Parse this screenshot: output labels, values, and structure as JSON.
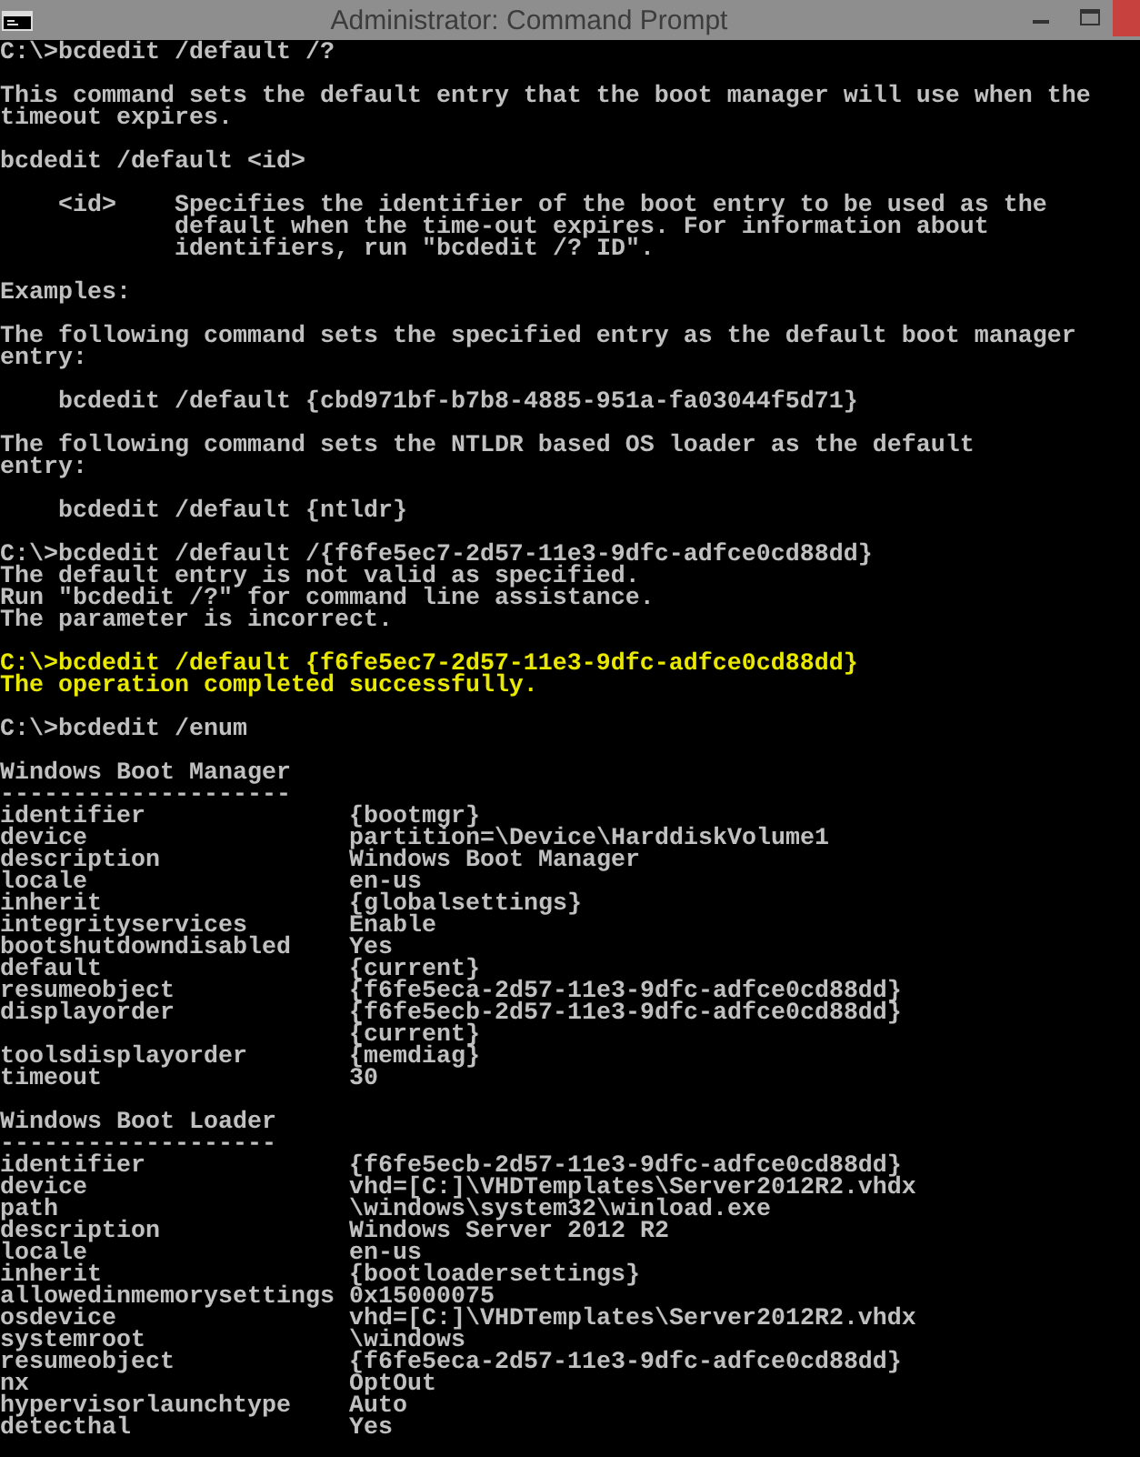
{
  "window": {
    "title": "Administrator: Command Prompt"
  },
  "console": [
    {
      "kind": "text",
      "lines": [
        {
          "text": "C:\\>bcdedit /default /?",
          "indent": false,
          "highlighted": false
        }
      ]
    },
    {
      "kind": "text",
      "lines": [
        {
          "text": "This command sets the default entry that the boot manager will use when the",
          "indent": false,
          "highlighted": false
        },
        {
          "text": "timeout expires.",
          "indent": false,
          "highlighted": false
        }
      ]
    },
    {
      "kind": "text",
      "lines": [
        {
          "text": "bcdedit /default <id>",
          "indent": false,
          "highlighted": false
        }
      ]
    },
    {
      "kind": "param",
      "name": "<id>",
      "lines": [
        "Specifies the identifier of the boot entry to be used as the",
        "default when the time-out expires. For information about",
        "identifiers, run \"bcdedit /? ID\"."
      ]
    },
    {
      "kind": "text",
      "lines": [
        {
          "text": "Examples:",
          "indent": false,
          "highlighted": false
        }
      ]
    },
    {
      "kind": "text",
      "lines": [
        {
          "text": "The following command sets the specified entry as the default boot manager",
          "indent": false,
          "highlighted": false
        },
        {
          "text": "entry:",
          "indent": false,
          "highlighted": false
        }
      ]
    },
    {
      "kind": "text",
      "lines": [
        {
          "text": "bcdedit /default {cbd971bf-b7b8-4885-951a-fa03044f5d71}",
          "indent": true,
          "highlighted": false
        }
      ]
    },
    {
      "kind": "text",
      "lines": [
        {
          "text": "The following command sets the NTLDR based OS loader as the default",
          "indent": false,
          "highlighted": false
        },
        {
          "text": "entry:",
          "indent": false,
          "highlighted": false
        }
      ]
    },
    {
      "kind": "text",
      "lines": [
        {
          "text": "bcdedit /default {ntldr}",
          "indent": true,
          "highlighted": false
        }
      ]
    },
    {
      "kind": "text",
      "lines": [
        {
          "text": "C:\\>bcdedit /default /{f6fe5ec7-2d57-11e3-9dfc-adfce0cd88dd}",
          "indent": false,
          "highlighted": false
        },
        {
          "text": "The default entry is not valid as specified.",
          "indent": false,
          "highlighted": false
        },
        {
          "text": "Run \"bcdedit /?\" for command line assistance.",
          "indent": false,
          "highlighted": false
        },
        {
          "text": "The parameter is incorrect.",
          "indent": false,
          "highlighted": false
        }
      ]
    },
    {
      "kind": "text",
      "lines": [
        {
          "text": "C:\\>bcdedit /default {f6fe5ec7-2d57-11e3-9dfc-adfce0cd88dd}",
          "indent": false,
          "highlighted": true
        },
        {
          "text": "The operation completed successfully.",
          "indent": false,
          "highlighted": true
        }
      ]
    },
    {
      "kind": "text",
      "lines": [
        {
          "text": "C:\\>bcdedit /enum",
          "indent": false,
          "highlighted": false
        }
      ]
    },
    {
      "kind": "table",
      "title": "Windows Boot Manager",
      "rule": "--------------------",
      "entries": [
        {
          "key": "identifier",
          "values": [
            "{bootmgr}"
          ]
        },
        {
          "key": "device",
          "values": [
            "partition=\\Device\\HarddiskVolume1"
          ]
        },
        {
          "key": "description",
          "values": [
            "Windows Boot Manager"
          ]
        },
        {
          "key": "locale",
          "values": [
            "en-us"
          ]
        },
        {
          "key": "inherit",
          "values": [
            "{globalsettings}"
          ]
        },
        {
          "key": "integrityservices",
          "values": [
            "Enable"
          ]
        },
        {
          "key": "bootshutdowndisabled",
          "values": [
            "Yes"
          ]
        },
        {
          "key": "default",
          "values": [
            "{current}"
          ]
        },
        {
          "key": "resumeobject",
          "values": [
            "{f6fe5eca-2d57-11e3-9dfc-adfce0cd88dd}"
          ]
        },
        {
          "key": "displayorder",
          "values": [
            "{f6fe5ecb-2d57-11e3-9dfc-adfce0cd88dd}",
            "{current}"
          ]
        },
        {
          "key": "toolsdisplayorder",
          "values": [
            "{memdiag}"
          ]
        },
        {
          "key": "timeout",
          "values": [
            "30"
          ]
        }
      ]
    },
    {
      "kind": "table",
      "title": "Windows Boot Loader",
      "rule": "-------------------",
      "entries": [
        {
          "key": "identifier",
          "values": [
            "{f6fe5ecb-2d57-11e3-9dfc-adfce0cd88dd}"
          ]
        },
        {
          "key": "device",
          "values": [
            "vhd=[C:]\\VHDTemplates\\Server2012R2.vhdx"
          ]
        },
        {
          "key": "path",
          "values": [
            "\\windows\\system32\\winload.exe"
          ]
        },
        {
          "key": "description",
          "values": [
            "Windows Server 2012 R2"
          ]
        },
        {
          "key": "locale",
          "values": [
            "en-us"
          ]
        },
        {
          "key": "inherit",
          "values": [
            "{bootloadersettings}"
          ]
        },
        {
          "key": "allowedinmemorysettings",
          "values": [
            "0x15000075"
          ]
        },
        {
          "key": "osdevice",
          "values": [
            "vhd=[C:]\\VHDTemplates\\Server2012R2.vhdx"
          ]
        },
        {
          "key": "systemroot",
          "values": [
            "\\windows"
          ]
        },
        {
          "key": "resumeobject",
          "values": [
            "{f6fe5eca-2d57-11e3-9dfc-adfce0cd88dd}"
          ]
        },
        {
          "key": "nx",
          "values": [
            "OptOut"
          ]
        },
        {
          "key": "hypervisorlaunchtype",
          "values": [
            "Auto"
          ]
        },
        {
          "key": "detecthal",
          "values": [
            "Yes"
          ]
        }
      ]
    }
  ]
}
